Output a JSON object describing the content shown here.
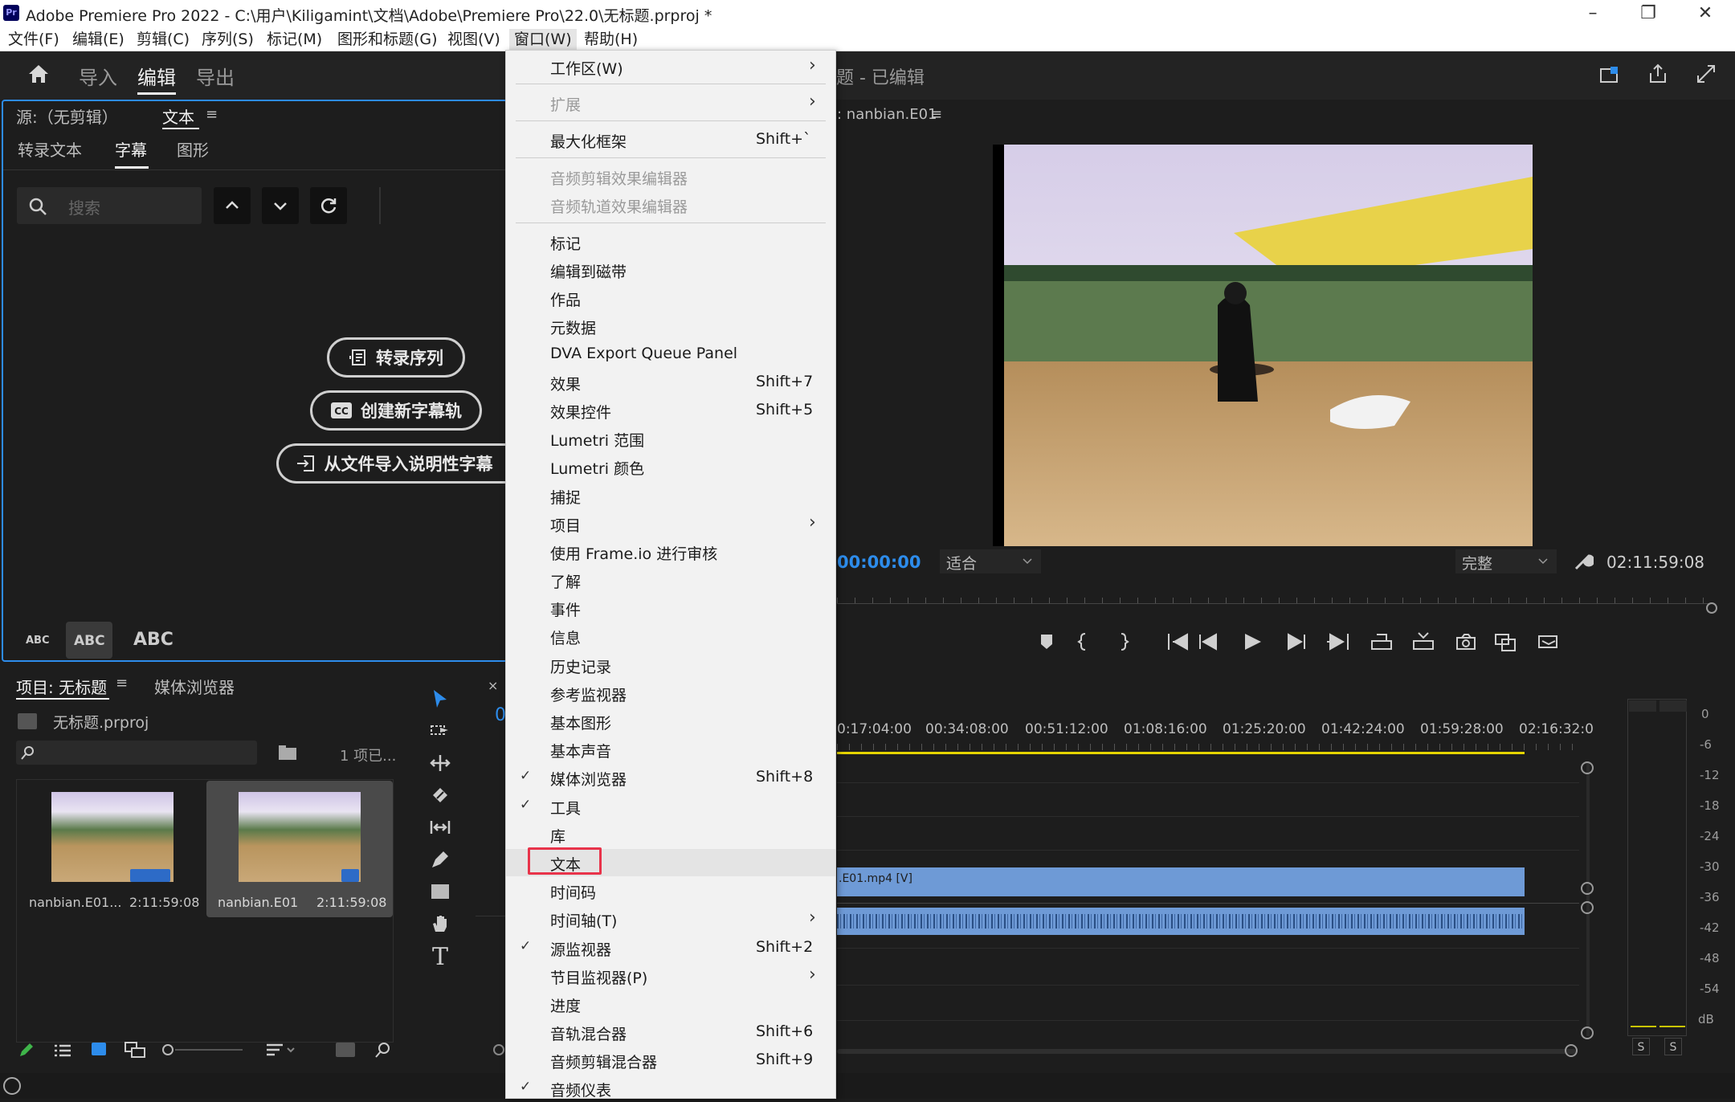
{
  "window": {
    "title": "Adobe Premiere Pro 2022 - C:\\用户\\Kiligamint\\文档\\Adobe\\Premiere Pro\\22.0\\无标题.prproj *",
    "app_badge": "Pr"
  },
  "menubar": [
    "文件(F)",
    "编辑(E)",
    "剪辑(C)",
    "序列(S)",
    "标记(M)",
    "图形和标题(G)",
    "视图(V)",
    "窗口(W)",
    "帮助(H)"
  ],
  "header": {
    "tabs": [
      "导入",
      "编辑",
      "导出"
    ],
    "active": "编辑",
    "sequence_title": "题 - 已编辑"
  },
  "source_panel": {
    "tab_source": "源:（无剪辑）",
    "tab_text": "文本",
    "subtabs": [
      "转录文本",
      "字幕",
      "图形"
    ],
    "search_placeholder": "搜索",
    "btn_transcribe": "转录序列",
    "btn_new_caption": "创建新字幕轨",
    "btn_import": "从文件导入说明性字幕",
    "abc": [
      "ABC",
      "ABC",
      "ABC"
    ]
  },
  "project_panel": {
    "tab_project": "项目: 无标题",
    "tab_media": "媒体浏览器",
    "file": "无标题.prproj",
    "count": "1 项已...",
    "items": [
      {
        "name": "nanbian.E01...",
        "duration": "2:11:59:08"
      },
      {
        "name": "nanbian.E01",
        "duration": "2:11:59:08"
      }
    ]
  },
  "program_monitor": {
    "tab": ": nanbian.E01",
    "timecode_left": "00:00:00",
    "fit": "适合",
    "quality": "完整",
    "timecode_right": "02:11:59:08"
  },
  "timeline": {
    "ticks": [
      "0:17:04:00",
      "00:34:08:00",
      "00:51:12:00",
      "01:08:16:00",
      "01:25:20:00",
      "01:42:24:00",
      "01:59:28:00",
      "02:16:32:0"
    ],
    "clip_label": ".E01.mp4 [V]"
  },
  "meter": {
    "labels": [
      "0",
      "-6",
      "-12",
      "-18",
      "-24",
      "-30",
      "-36",
      "-42",
      "-48",
      "-54",
      "dB"
    ],
    "solo": [
      "S",
      "S"
    ]
  },
  "window_menu": {
    "items": [
      {
        "label": "工作区(W)",
        "submenu": true
      },
      {
        "sep": true
      },
      {
        "label": "扩展",
        "submenu": true,
        "disabled": true
      },
      {
        "sep": true
      },
      {
        "label": "最大化框架",
        "shortcut": "Shift+`"
      },
      {
        "sep": true
      },
      {
        "label": "音频剪辑效果编辑器",
        "disabled": true
      },
      {
        "label": "音频轨道效果编辑器",
        "disabled": true
      },
      {
        "sep": true
      },
      {
        "label": "标记"
      },
      {
        "label": "编辑到磁带"
      },
      {
        "label": "作品"
      },
      {
        "label": "元数据"
      },
      {
        "label": "DVA Export Queue Panel"
      },
      {
        "label": "效果",
        "shortcut": "Shift+7"
      },
      {
        "label": "效果控件",
        "shortcut": "Shift+5"
      },
      {
        "label": "Lumetri 范围"
      },
      {
        "label": "Lumetri 颜色"
      },
      {
        "label": "捕捉"
      },
      {
        "label": "项目",
        "submenu": true
      },
      {
        "label": "使用 Frame.io 进行审核"
      },
      {
        "label": "了解"
      },
      {
        "label": "事件"
      },
      {
        "label": "信息"
      },
      {
        "label": "历史记录"
      },
      {
        "label": "参考监视器"
      },
      {
        "label": "基本图形"
      },
      {
        "label": "基本声音"
      },
      {
        "label": "媒体浏览器",
        "shortcut": "Shift+8",
        "checked": true
      },
      {
        "label": "工具",
        "checked": true
      },
      {
        "label": "库"
      },
      {
        "label": "文本",
        "hover": true
      },
      {
        "label": "时间码"
      },
      {
        "label": "时间轴(T)",
        "submenu": true
      },
      {
        "label": "源监视器",
        "shortcut": "Shift+2",
        "checked": true
      },
      {
        "label": "节目监视器(P)",
        "submenu": true
      },
      {
        "label": "进度"
      },
      {
        "label": "音轨混合器",
        "shortcut": "Shift+6"
      },
      {
        "label": "音频剪辑混合器",
        "shortcut": "Shift+9"
      },
      {
        "label": "音频仪表",
        "checked": true
      }
    ]
  },
  "colors": {
    "accent": "#2d8ceb",
    "highlight": "#e8334a",
    "clip_blue": "#6e9ad6",
    "playhead_yellow": "#e5d400"
  }
}
